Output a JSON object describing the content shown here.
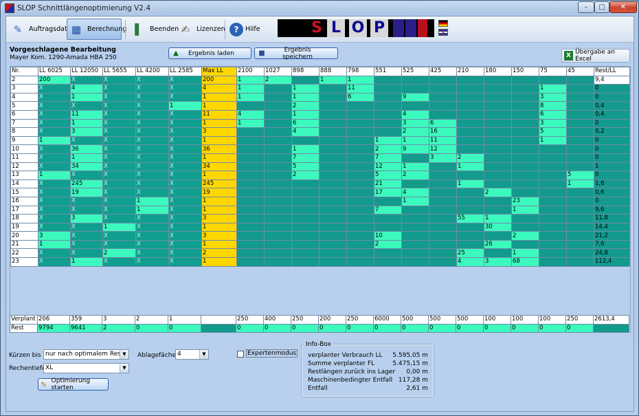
{
  "window": {
    "title": "SLOP Schnittlängenoptimierung V2.4"
  },
  "toolbar": {
    "auftragsdaten": "Auftragsdaten",
    "berechnung": "Berechnung",
    "beenden": "Beenden",
    "lizenzen": "Lizenzen",
    "hilfe": "Hilfe"
  },
  "logo": {
    "letters": [
      "S",
      "L",
      "O",
      "P"
    ]
  },
  "header": {
    "title": "Vorgeschlagene Bearbeitung",
    "subtitle": "Mayer Kom. 1290-Amada HBA  250"
  },
  "buttons": {
    "load": "Ergebnis laden",
    "save": "Ergebnis speichern",
    "excel": "Übergabe an Excel",
    "optimize": "Optimierung starten"
  },
  "grid": {
    "columns": [
      "Nr.",
      "LL 6025",
      "LL 12050",
      "LL 5655",
      "LL 4200",
      "LL 2585",
      "Max LL",
      "2100",
      "1027",
      "898",
      "888",
      "798",
      "551",
      "525",
      "425",
      "210",
      "180",
      "150",
      "75",
      "45",
      "Rest/LL"
    ],
    "rows": [
      [
        "2",
        "200",
        "X",
        "X",
        "X",
        "X",
        "200",
        "1",
        "2",
        "",
        "1",
        "1",
        "",
        "",
        "",
        "",
        "",
        "",
        "",
        "",
        "9,4"
      ],
      [
        "3",
        "X",
        "4",
        "X",
        "X",
        "X",
        "4",
        "1",
        "",
        "1",
        "",
        "11",
        "",
        "",
        "",
        "",
        "",
        "",
        "1",
        "",
        "0"
      ],
      [
        "4",
        "X",
        "1",
        "X",
        "X",
        "X",
        "1",
        "1",
        "",
        "1",
        "",
        "6",
        "",
        "9",
        "",
        "",
        "",
        "",
        "3",
        "",
        "0"
      ],
      [
        "5",
        "X",
        "X",
        "X",
        "X",
        "1",
        "1",
        "",
        "",
        "2",
        "",
        "",
        "",
        "",
        "",
        "",
        "",
        "",
        "8",
        "",
        "0,4"
      ],
      [
        "6",
        "X",
        "11",
        "X",
        "X",
        "X",
        "11",
        "4",
        "",
        "1",
        "",
        "",
        "",
        "4",
        "",
        "",
        "",
        "",
        "6",
        "",
        "0,4"
      ],
      [
        "7",
        "X",
        "1",
        "X",
        "X",
        "X",
        "1",
        "1",
        "",
        "6",
        "",
        "",
        "",
        "3",
        "6",
        "",
        "",
        "",
        "3",
        "",
        "0"
      ],
      [
        "8",
        "X",
        "3",
        "X",
        "X",
        "X",
        "3",
        "",
        "",
        "4",
        "",
        "",
        "",
        "2",
        "16",
        "",
        "",
        "",
        "5",
        "",
        "0,2"
      ],
      [
        "9",
        "1",
        "X",
        "X",
        "X",
        "X",
        "1",
        "",
        "",
        "",
        "",
        "",
        "1",
        "1",
        "11",
        "",
        "",
        "",
        "1",
        "",
        "0"
      ],
      [
        "10",
        "X",
        "36",
        "X",
        "X",
        "X",
        "36",
        "",
        "",
        "1",
        "",
        "",
        "2",
        "9",
        "12",
        "",
        "",
        "",
        "",
        "",
        "0"
      ],
      [
        "11",
        "X",
        "1",
        "X",
        "X",
        "X",
        "1",
        "",
        "",
        "7",
        "",
        "",
        "7",
        "",
        "3",
        "2",
        "",
        "",
        "",
        "",
        "0"
      ],
      [
        "12",
        "X",
        "34",
        "X",
        "X",
        "X",
        "34",
        "",
        "",
        "5",
        "",
        "",
        "12",
        "1",
        "",
        "1",
        "",
        "",
        "",
        "",
        "1"
      ],
      [
        "13",
        "1",
        "X",
        "X",
        "X",
        "X",
        "1",
        "",
        "",
        "2",
        "",
        "",
        "5",
        "2",
        "",
        "",
        "",
        "",
        "",
        "5",
        "0"
      ],
      [
        "14",
        "X",
        "245",
        "X",
        "X",
        "X",
        "245",
        "",
        "",
        "",
        "",
        "",
        "21",
        "",
        "",
        "1",
        "",
        "",
        "",
        "1",
        "1,6"
      ],
      [
        "15",
        "X",
        "19",
        "X",
        "X",
        "X",
        "19",
        "",
        "",
        "",
        "",
        "",
        "17",
        "4",
        "",
        "",
        "2",
        "",
        "",
        "",
        "0,6"
      ],
      [
        "16",
        "X",
        "X",
        "X",
        "1",
        "X",
        "1",
        "",
        "",
        "",
        "",
        "",
        "",
        "1",
        "",
        "",
        "",
        "23",
        "",
        "",
        "0"
      ],
      [
        "17",
        "X",
        "X",
        "X",
        "1",
        "X",
        "1",
        "",
        "",
        "",
        "",
        "",
        "7",
        "",
        "",
        "",
        "",
        "1",
        "",
        "",
        "9,6"
      ],
      [
        "18",
        "X",
        "3",
        "X",
        "X",
        "X",
        "3",
        "",
        "",
        "",
        "",
        "",
        "",
        "",
        "",
        "55",
        "1",
        "",
        "",
        "",
        "11,8"
      ],
      [
        "19",
        "X",
        "X",
        "1",
        "X",
        "X",
        "1",
        "",
        "",
        "",
        "",
        "",
        "",
        "",
        "",
        "",
        "30",
        "",
        "",
        "",
        "14,4"
      ],
      [
        "20",
        "3",
        "X",
        "X",
        "X",
        "X",
        "3",
        "",
        "",
        "",
        "",
        "",
        "10",
        "",
        "",
        "",
        "",
        "2",
        "",
        "",
        "21,2"
      ],
      [
        "21",
        "1",
        "X",
        "X",
        "X",
        "X",
        "1",
        "",
        "",
        "",
        "",
        "",
        "2",
        "",
        "",
        "",
        "26",
        "",
        "",
        "",
        "7,6"
      ],
      [
        "22",
        "X",
        "X",
        "2",
        "X",
        "X",
        "2",
        "",
        "",
        "",
        "",
        "",
        "",
        "",
        "",
        "25",
        "",
        "1",
        "",
        "",
        "24,8"
      ],
      [
        "23",
        "X",
        "1",
        "X",
        "X",
        "X",
        "1",
        "",
        "",
        "",
        "",
        "",
        "",
        "",
        "",
        "4",
        "3",
        "68",
        "",
        "",
        "112,4"
      ]
    ],
    "verplant": [
      "Verplant",
      "206",
      "359",
      "3",
      "2",
      "1",
      "",
      "250",
      "400",
      "250",
      "200",
      "250",
      "6000",
      "500",
      "500",
      "500",
      "100",
      "100",
      "100",
      "250",
      "2613,4"
    ],
    "rest": [
      "Rest",
      "9794",
      "9641",
      "2",
      "0",
      "0",
      "",
      "0",
      "0",
      "0",
      "0",
      "0",
      "0",
      "0",
      "0",
      "0",
      "0",
      "0",
      "0",
      "0",
      ""
    ]
  },
  "controls": {
    "kuerzen_label": "Kürzen bis",
    "kuerzen_value": "nur nach optimalem Rest",
    "rechentiefe_label": "Rechentiefe",
    "rechentiefe_value": "XL",
    "ablage_label": "Ablagefächer",
    "ablage_value": "4",
    "experten_label": "Expertenmodus"
  },
  "info": {
    "title": "Info-Box",
    "rows": [
      {
        "label": "verplanter Verbrauch LL",
        "value": "5.595,05 m"
      },
      {
        "label": "Summe verplanter FL",
        "value": "5.475,15 m"
      },
      {
        "label": "Restlängen zurück ins Lager",
        "value": "0,00 m"
      },
      {
        "label": "Maschinenbedingter Entfall",
        "value": "117,28 m"
      },
      {
        "label": "Entfall",
        "value": "2,61 m"
      }
    ]
  }
}
